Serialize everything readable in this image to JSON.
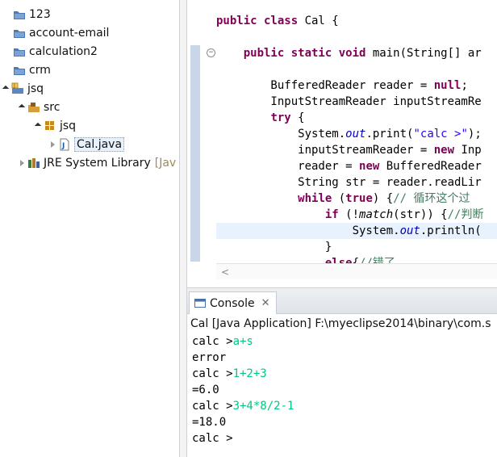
{
  "explorer": {
    "items": [
      {
        "label": "123",
        "icon": "folder-icon",
        "twisty": "none"
      },
      {
        "label": "account-email",
        "icon": "folder-icon",
        "twisty": "none"
      },
      {
        "label": "calculation2",
        "icon": "folder-icon",
        "twisty": "none"
      },
      {
        "label": "crm",
        "icon": "folder-icon",
        "twisty": "none"
      },
      {
        "label": "jsq",
        "icon": "java-project-icon",
        "twisty": "open"
      },
      {
        "label": "src",
        "icon": "source-folder-icon",
        "twisty": "open"
      },
      {
        "label": "jsq",
        "icon": "package-icon",
        "twisty": "open"
      },
      {
        "label": "Cal.java",
        "icon": "java-file-icon",
        "twisty": "closed"
      },
      {
        "label": "JRE System Library",
        "suffix": "[Jav",
        "icon": "library-icon",
        "twisty": "closed"
      }
    ]
  },
  "editor": {
    "lines": [
      {
        "parts": [
          {
            "t": "public class ",
            "c": "kw"
          },
          {
            "t": "Cal {",
            "c": ""
          }
        ]
      },
      {
        "parts": [
          {
            "t": "",
            "c": ""
          }
        ]
      },
      {
        "parts": [
          {
            "t": "    ",
            "c": ""
          },
          {
            "t": "public static void ",
            "c": "kw"
          },
          {
            "t": "main(String[] ar",
            "c": ""
          }
        ]
      },
      {
        "parts": [
          {
            "t": "",
            "c": ""
          }
        ]
      },
      {
        "parts": [
          {
            "t": "        BufferedReader reader = ",
            "c": ""
          },
          {
            "t": "null",
            "c": "kw"
          },
          {
            "t": ";",
            "c": ""
          }
        ]
      },
      {
        "parts": [
          {
            "t": "        InputStreamReader inputStreamRe",
            "c": ""
          }
        ]
      },
      {
        "parts": [
          {
            "t": "        ",
            "c": ""
          },
          {
            "t": "try",
            "c": "kw"
          },
          {
            "t": " {",
            "c": ""
          }
        ]
      },
      {
        "parts": [
          {
            "t": "            System.",
            "c": ""
          },
          {
            "t": "out",
            "c": "it"
          },
          {
            "t": ".print(",
            "c": ""
          },
          {
            "t": "\"calc >\"",
            "c": "st"
          },
          {
            "t": ");",
            "c": ""
          }
        ]
      },
      {
        "parts": [
          {
            "t": "            inputStreamReader = ",
            "c": ""
          },
          {
            "t": "new",
            "c": "kw"
          },
          {
            "t": " Inp",
            "c": ""
          }
        ]
      },
      {
        "parts": [
          {
            "t": "            reader = ",
            "c": ""
          },
          {
            "t": "new",
            "c": "kw"
          },
          {
            "t": " BufferedReader",
            "c": ""
          }
        ]
      },
      {
        "parts": [
          {
            "t": "            String str = reader.readLir",
            "c": ""
          }
        ]
      },
      {
        "parts": [
          {
            "t": "            ",
            "c": ""
          },
          {
            "t": "while",
            "c": "kw"
          },
          {
            "t": " (",
            "c": ""
          },
          {
            "t": "true",
            "c": "kw"
          },
          {
            "t": ") {",
            "c": ""
          },
          {
            "t": "// 循环这个过",
            "c": "cm"
          }
        ]
      },
      {
        "parts": [
          {
            "t": "                ",
            "c": ""
          },
          {
            "t": "if",
            "c": "kw"
          },
          {
            "t": " (!",
            "c": ""
          },
          {
            "t": "match",
            "c": "itb"
          },
          {
            "t": "(str)) {",
            "c": ""
          },
          {
            "t": "//判断",
            "c": "cm"
          }
        ]
      },
      {
        "parts": [
          {
            "t": "                    System.",
            "c": ""
          },
          {
            "t": "out",
            "c": "it"
          },
          {
            "t": ".println(",
            "c": ""
          }
        ],
        "highlight": true
      },
      {
        "parts": [
          {
            "t": "                }",
            "c": ""
          }
        ]
      },
      {
        "parts": [
          {
            "t": "                ",
            "c": ""
          },
          {
            "t": "else",
            "c": "kw"
          },
          {
            "t": "{",
            "c": ""
          },
          {
            "t": "//错了",
            "c": "cm"
          }
        ]
      }
    ]
  },
  "console": {
    "tab_label": "Console",
    "close_glyph": "✕",
    "title": "Cal [Java Application] F:\\myeclipse2014\\binary\\com.s",
    "lines": [
      {
        "prompt": "calc >",
        "input": "a+s"
      },
      {
        "prompt": "error",
        "input": ""
      },
      {
        "prompt": "calc >",
        "input": "1+2+3"
      },
      {
        "prompt": "=6.0",
        "input": ""
      },
      {
        "prompt": "calc >",
        "input": "3+4*8/2-1"
      },
      {
        "prompt": "=18.0",
        "input": ""
      },
      {
        "prompt": "calc >",
        "input": ""
      }
    ]
  },
  "colors": {
    "keyword": "#7f0055",
    "string": "#2a00ff",
    "comment": "#3f7f5f",
    "field": "#0000c0",
    "console_input": "#00c87f",
    "current_line": "#e8f2fe"
  }
}
